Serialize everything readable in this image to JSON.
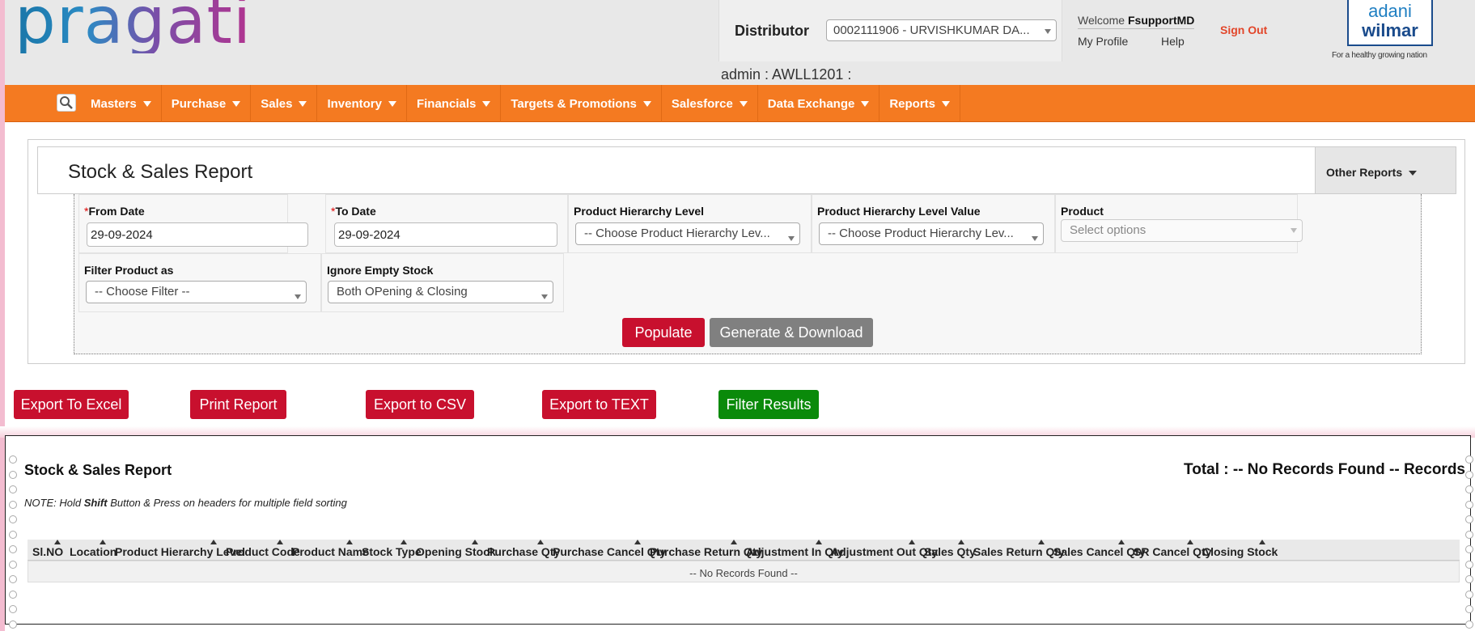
{
  "header": {
    "logo": "pragati",
    "distributor_label": "Distributor",
    "distributor_value": "0002111906 - URVISHKUMAR DA...",
    "welcome_text": "Welcome",
    "welcome_user": "FsupportMD",
    "my_profile": "My Profile",
    "help": "Help",
    "sign_out": "Sign Out",
    "brand_line1": "adani",
    "brand_line2": "wilmar",
    "brand_tagline": "For a healthy growing nation",
    "admin_line": "admin : AWLL1201 :"
  },
  "nav": {
    "items": [
      "Masters",
      "Purchase",
      "Sales",
      "Inventory",
      "Financials",
      "Targets & Promotions",
      "Salesforce",
      "Data Exchange",
      "Reports"
    ]
  },
  "page": {
    "title": "Stock & Sales Report",
    "other_reports": "Other Reports"
  },
  "form": {
    "from_date_label": "From Date",
    "from_date_value": "29-09-2024",
    "to_date_label": "To Date",
    "to_date_value": "29-09-2024",
    "phl_label": "Product Hierarchy Level",
    "phl_value": "-- Choose Product Hierarchy Lev...",
    "phlv_label": "Product Hierarchy Level Value",
    "phlv_value": "-- Choose Product Hierarchy Lev...",
    "product_label": "Product",
    "product_placeholder": "Select options",
    "filter_label": "Filter Product as",
    "filter_value": "-- Choose Filter --",
    "ignore_label": "Ignore Empty Stock",
    "ignore_value": "Both OPening & Closing",
    "populate": "Populate",
    "generate": "Generate & Download",
    "required_mark": "*"
  },
  "actions": {
    "export_excel": "Export To Excel",
    "print": "Print Report",
    "export_csv": "Export to CSV",
    "export_text": "Export to TEXT",
    "filter": "Filter Results"
  },
  "results": {
    "title": "Stock & Sales Report",
    "total": "Total : -- No Records Found -- Records",
    "note_pre": "NOTE: Hold ",
    "note_key": "Shift",
    "note_post": " Button & Press on headers for multiple field sorting",
    "columns": [
      "Sl.NO",
      "Location",
      "Product Hierarchy Level",
      "Product Code",
      "Product Name",
      "Stock Type",
      "Opening Stock",
      "Purchase Qty",
      "Purchase Cancel Qty",
      "Purchase Return Qty",
      "Adjustment In Qty",
      "Adjustment Out Qty",
      "Sales Qty",
      "Sales Return Qty",
      "Sales Cancel Qty",
      "SR Cancel Qty",
      "Closing Stock"
    ],
    "empty": "-- No Records Found --"
  },
  "colors": {
    "nav": "#f47a21",
    "primary_button": "#c8102e",
    "secondary_button": "#808080",
    "success_button": "#0a8a0a",
    "sign_out": "#e2462a"
  }
}
